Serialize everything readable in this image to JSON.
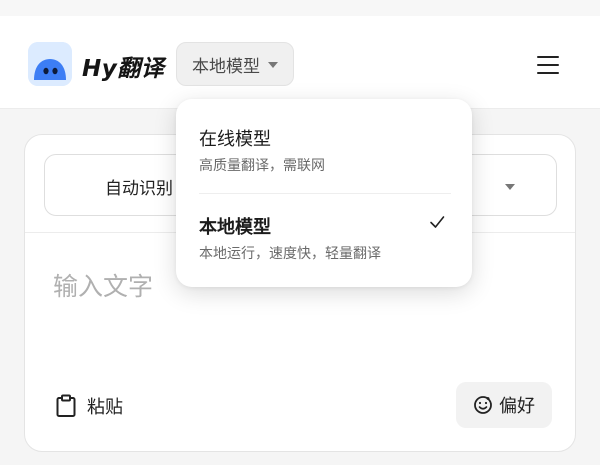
{
  "header": {
    "app_name": "Hy翻译",
    "model_selector": {
      "label": "本地模型"
    }
  },
  "model_dropdown": {
    "options": [
      {
        "title": "在线模型",
        "description": "高质量翻译，需联网",
        "selected": false
      },
      {
        "title": "本地模型",
        "description": "本地运行，速度快，轻量翻译",
        "selected": true
      }
    ]
  },
  "translator": {
    "source_language": "自动识别",
    "input": {
      "placeholder": "输入文字",
      "value": ""
    },
    "paste_label": "粘贴",
    "preference_label": "偏好"
  },
  "colors": {
    "accent": "#3d7ef5",
    "logo_bg": "#dcebff"
  },
  "icons": [
    "app-logo-icon",
    "chevron-down-icon",
    "menu-icon",
    "checkmark-icon",
    "clipboard-icon",
    "smile-icon"
  ]
}
